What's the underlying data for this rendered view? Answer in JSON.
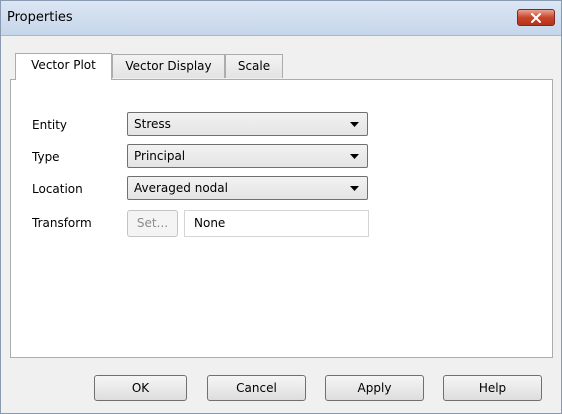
{
  "window": {
    "title": "Properties"
  },
  "tabs": [
    {
      "label": "Vector Plot",
      "active": true
    },
    {
      "label": "Vector Display",
      "active": false
    },
    {
      "label": "Scale",
      "active": false
    }
  ],
  "form": {
    "entity": {
      "label": "Entity",
      "value": "Stress"
    },
    "type": {
      "label": "Type",
      "value": "Principal"
    },
    "location": {
      "label": "Location",
      "value": "Averaged nodal"
    },
    "transform": {
      "label": "Transform",
      "button": "Set...",
      "value": "None"
    }
  },
  "buttons": {
    "ok": "OK",
    "cancel": "Cancel",
    "apply": "Apply",
    "help": "Help"
  },
  "colors": {
    "close_button": "#c9452c",
    "background": "#f0f0f0",
    "panel": "#ffffff"
  }
}
